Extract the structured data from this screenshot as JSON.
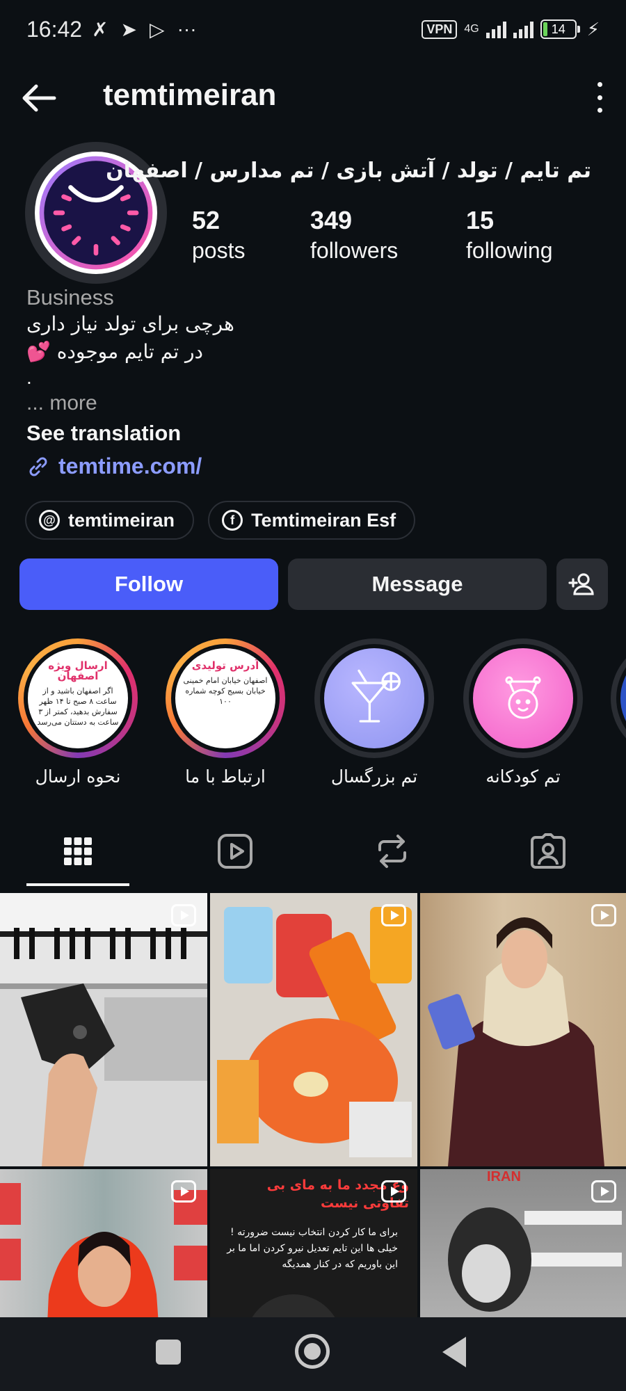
{
  "status_bar": {
    "time": "16:42",
    "vpn": "VPN",
    "network": "4G",
    "battery": "14",
    "battery_level": 0.14
  },
  "header": {
    "username": "temtimeiran"
  },
  "profile": {
    "full_name": "تم تایم / تولد / آتش بازی / تم مدارس / اصفهان",
    "stats": [
      {
        "value": "52",
        "label": "posts"
      },
      {
        "value": "349",
        "label": "followers"
      },
      {
        "value": "15",
        "label": "following"
      }
    ],
    "category": "Business",
    "bio_lines": [
      "هرچی برای تولد نیاز داری",
      "در تم تایم موجوده 💕",
      "."
    ],
    "more": "... more",
    "see_translation": "See translation",
    "link": "temtime.com/",
    "pills": [
      {
        "icon": "threads-icon",
        "label": "temtimeiran"
      },
      {
        "icon": "facebook-icon",
        "label": "Temtimeiran Esf"
      }
    ]
  },
  "actions": {
    "follow": "Follow",
    "message": "Message"
  },
  "highlights": [
    {
      "label": "نحوه ارسال",
      "card_title": "ارسال ویژه اصفهان",
      "card_text": "اگر اصفهان باشید و از ساعت ۸ صبح تا ۱۴ ظهر سفارش بدهید، کمتر از ۳ ساعت به دستتان می‌رسد"
    },
    {
      "label": "ارتباط با ما",
      "card_title": "آدرس تولیدی",
      "card_text": "اصفهان خیابان امام خمینی خیابان بسیج کوچه شماره ۱۰۰"
    },
    {
      "label": "تم بزرگسال",
      "icon": "cocktail-icon"
    },
    {
      "label": "تم کودکانه",
      "icon": "baby-icon"
    }
  ],
  "tabs": [
    {
      "name": "tab-posts",
      "icon": "grid-icon"
    },
    {
      "name": "tab-reels",
      "icon": "reels-icon"
    },
    {
      "name": "tab-reposts",
      "icon": "repost-icon"
    },
    {
      "name": "tab-tagged",
      "icon": "tagged-icon"
    }
  ],
  "grid_posts": [
    {
      "type": "reel"
    },
    {
      "type": "reel"
    },
    {
      "type": "reel"
    },
    {
      "type": "reel"
    },
    {
      "type": "reel",
      "overlay_title": "وع مجدد ما به مای بی تفاوتی نیست",
      "overlay_text": "برای ما کار کردن انتخاب نیست ضرورته ! خیلی ها این تایم تعدیل نیرو کردن اما ما بر این باوریم که در کنار همدیگه"
    },
    {
      "type": "reel",
      "overlay_title": "IRAN"
    }
  ],
  "colors": {
    "background": "#0c1014",
    "follow_button": "#4a5df9",
    "secondary_button": "#2a2d33",
    "link": "#8c9cff"
  }
}
